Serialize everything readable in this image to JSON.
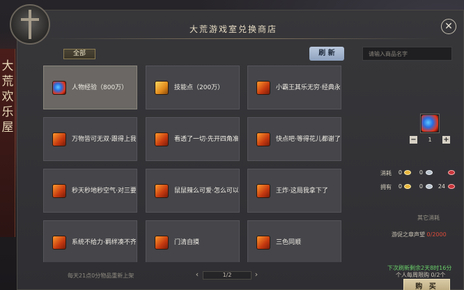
{
  "side_title": "大荒欢乐屋",
  "shop": {
    "title": "大荒游戏室兑换商店",
    "category_tab": "全部",
    "refresh_button": "刷 新",
    "close_icon": "close-icon",
    "search_placeholder": "请输入商品名字"
  },
  "items": [
    {
      "name": "人物经验（800万）",
      "icon": "exp-orb-icon",
      "selected": true
    },
    {
      "name": "技能点（200万）",
      "icon": "skill-point-icon",
      "selected": false
    },
    {
      "name": "小霸王其乐无穷·经典永",
      "icon": "gift-box-icon",
      "selected": false
    },
    {
      "name": "万物皆可无双·跟得上我",
      "icon": "gift-box-icon",
      "selected": false
    },
    {
      "name": "看透了一切·先开四角准",
      "icon": "gift-box-icon",
      "selected": false
    },
    {
      "name": "快点吧·等得花儿都谢了",
      "icon": "gift-box-icon",
      "selected": false
    },
    {
      "name": "秒天秒地秒空气·对三要",
      "icon": "gift-box-icon",
      "selected": false
    },
    {
      "name": "鼠鼠辣么可爱·怎么可以",
      "icon": "gift-box-icon",
      "selected": false
    },
    {
      "name": "王炸·这局我拿下了",
      "icon": "gift-box-icon",
      "selected": false
    },
    {
      "name": "系统不给力·羁绊凑不齐",
      "icon": "gift-box-icon",
      "selected": false
    },
    {
      "name": "门清自摸",
      "icon": "gift-box-icon",
      "selected": false
    },
    {
      "name": "三色同顺",
      "icon": "gift-box-icon",
      "selected": false
    }
  ],
  "footer": {
    "note": "每天21点0分物品重新上架",
    "page": "1/2"
  },
  "detail": {
    "quantity": "1",
    "cost_label": "消耗",
    "own_label": "拥有",
    "cost_values": [
      "0",
      "0"
    ],
    "own_values": [
      "0",
      "0",
      "24"
    ],
    "other_cost_label": "其它消耗",
    "reputation_label": "游促之章声望 ",
    "reputation_value": "0/2000",
    "refresh_countdown": "下次刷新剩余2天8时16分",
    "personal_limit": "个人每周限购 0/2个",
    "buy_button": "购 买"
  },
  "colors": {
    "panel_bg": "#37373a",
    "card_bg": "#45454a",
    "selected_card_bg": "#6a6764",
    "countdown_green": "#6ad06a",
    "reputation_red": "#e04a3a",
    "refresh_button_blue": "#a9b9d0"
  }
}
